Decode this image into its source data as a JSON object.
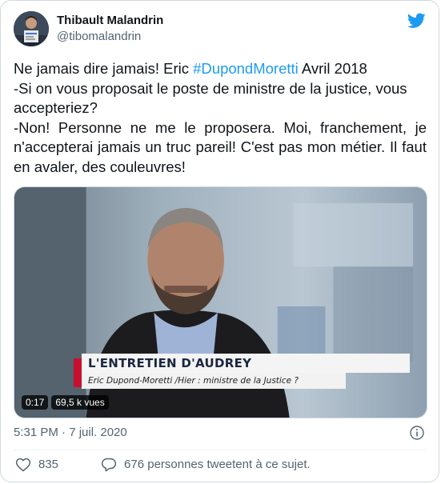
{
  "author": {
    "display_name": "Thibault Malandrin",
    "handle": "@tibomalandrin"
  },
  "tweet": {
    "text_before_hashtag": "Ne jamais dire jamais! Eric ",
    "hashtag": "#DupondMoretti",
    "text_after_hashtag": " Avril 2018",
    "line2": "-Si on vous proposait le poste de ministre de la justice, vous accepteriez?",
    "line3": "-Non! Personne ne me le proposera. Moi, franchement, je n'accepterai jamais un truc pareil! C'est pas mon métier. Il faut en avaler, des couleuvres!"
  },
  "video": {
    "lower_third_title": "L'ENTRETIEN D'AUDREY",
    "lower_third_subtitle": "Eric Dupond-Moretti /Hier : ministre de la Justice ?",
    "elapsed": "0:17",
    "views": "69,5 k vues"
  },
  "meta": {
    "timestamp": "5:31 PM · 7 juil. 2020"
  },
  "actions": {
    "like_count": "835",
    "reply_label": "676 personnes tweetent à ce sujet."
  },
  "colors": {
    "accent": "#1d9bf0",
    "secondary_text": "#536471",
    "border": "#cfd9de"
  },
  "icons": {
    "brand": "twitter-bird-icon",
    "info": "info-icon",
    "like": "heart-icon",
    "reply": "speech-bubble-icon"
  }
}
